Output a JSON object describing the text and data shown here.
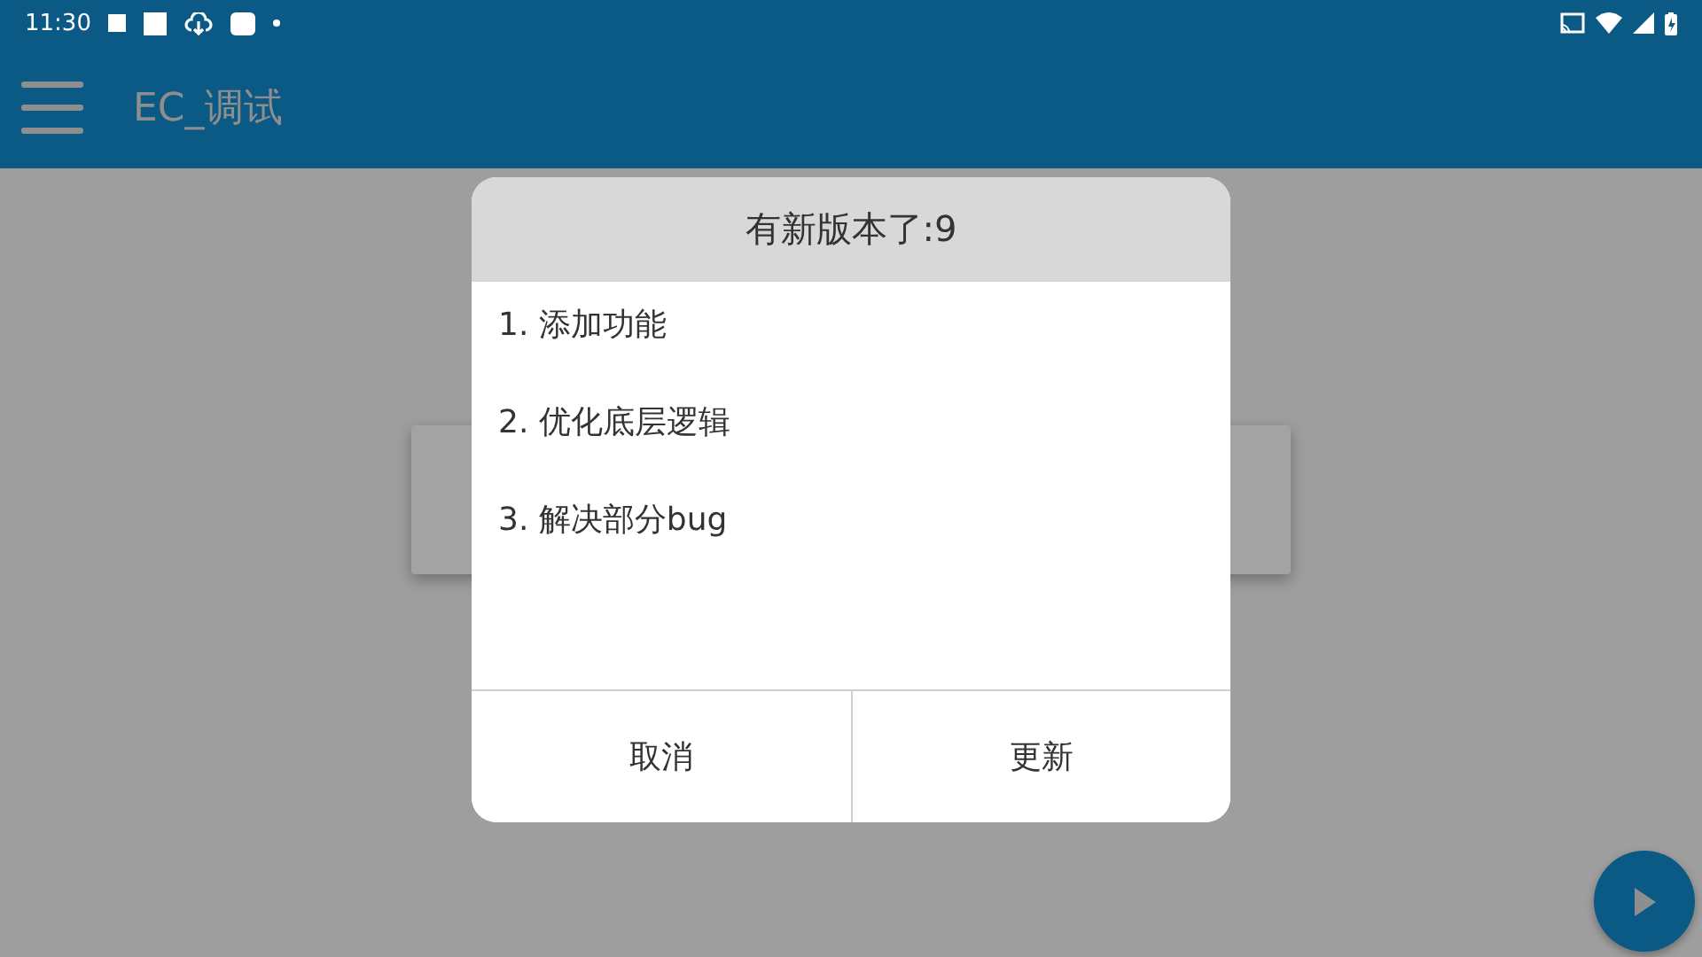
{
  "status_bar": {
    "time": "11:30"
  },
  "app_bar": {
    "title": "EC_调试"
  },
  "dialog": {
    "title": "有新版本了:9",
    "lines": [
      "1. 添加功能",
      "2. 优化底层逻辑",
      "3. 解决部分bug"
    ],
    "buttons": [
      "取消",
      "更新"
    ]
  }
}
